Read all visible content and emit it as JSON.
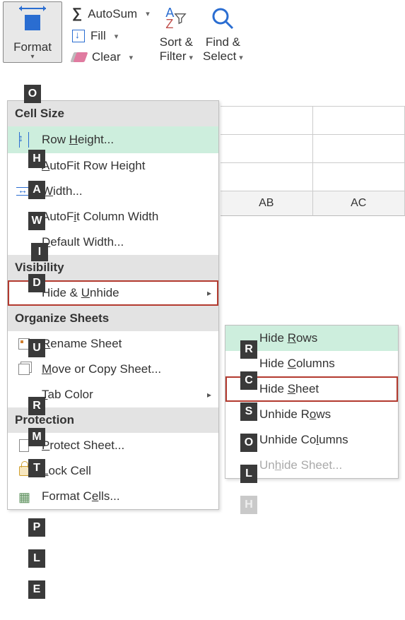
{
  "ribbon": {
    "format": {
      "label": "Format",
      "key": "O"
    },
    "autosum": "AutoSum",
    "fill": "Fill",
    "clear": "Clear",
    "sort": {
      "line1": "Sort &",
      "line2": "Filter"
    },
    "find": {
      "line1": "Find &",
      "line2": "Select"
    }
  },
  "menu1": {
    "headers": {
      "cell_size": "Cell Size",
      "visibility": "Visibility",
      "organize": "Organize Sheets",
      "protection": "Protection"
    },
    "items": {
      "row_height": {
        "pre": "Row ",
        "u": "H",
        "post": "eight...",
        "key": "H"
      },
      "autofit_row": {
        "pre": "",
        "u": "A",
        "post": "utoFit Row Height",
        "key": "A"
      },
      "col_width": {
        "pre": "",
        "u": "W",
        "post": "idth...",
        "key": "W"
      },
      "autofit_col": {
        "pre": "AutoF",
        "u": "i",
        "post": "t Column Width",
        "key": "I"
      },
      "default_width": {
        "pre": "",
        "u": "D",
        "post": "efault Width...",
        "key": "D"
      },
      "hide_unhide": {
        "pre": "Hide & ",
        "u": "U",
        "post": "nhide",
        "key": "U"
      },
      "rename": {
        "pre": "",
        "u": "R",
        "post": "ename Sheet",
        "key": "R"
      },
      "move_copy": {
        "pre": "",
        "u": "M",
        "post": "ove or Copy Sheet...",
        "key": "M"
      },
      "tab_color": {
        "pre": "",
        "u": "T",
        "post": "ab Color",
        "key": "T"
      },
      "protect_sheet": {
        "pre": "",
        "u": "P",
        "post": "rotect Sheet...",
        "key": "P"
      },
      "lock_cell": {
        "pre": "",
        "u": "L",
        "post": "ock Cell",
        "key": "L"
      },
      "format_cells": {
        "pre": "Format C",
        "u": "e",
        "post": "lls...",
        "key": "E"
      }
    }
  },
  "menu2": {
    "items": {
      "hide_rows": {
        "pre": "Hide ",
        "u": "R",
        "post": "ows",
        "key": "R"
      },
      "hide_cols": {
        "pre": "Hide ",
        "u": "C",
        "post": "olumns",
        "key": "C"
      },
      "hide_sheet": {
        "pre": "Hide ",
        "u": "S",
        "post": "heet",
        "key": "S"
      },
      "unhide_rows": {
        "pre": "Unhide R",
        "u": "o",
        "post": "ws",
        "key": "O"
      },
      "unhide_cols": {
        "pre": "Unhide Co",
        "u": "l",
        "post": "umns",
        "key": "L"
      },
      "unhide_sheet": {
        "pre": "Un",
        "u": "h",
        "post": "ide Sheet...",
        "key": "H"
      }
    }
  },
  "grid": {
    "cols": [
      "AB",
      "AC"
    ]
  }
}
